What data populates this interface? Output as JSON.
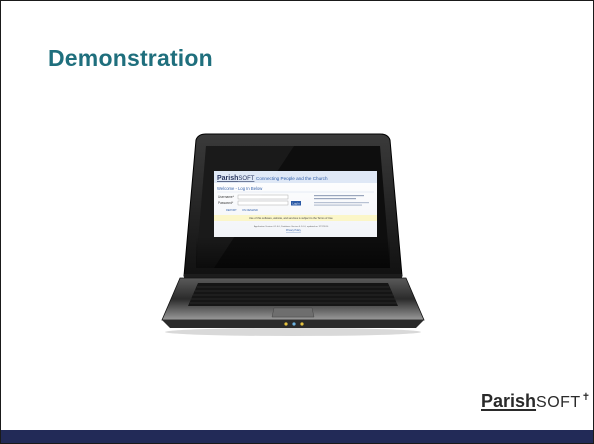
{
  "slide": {
    "title": "Demonstration"
  },
  "screen": {
    "logo_bold": "Parish",
    "logo_light": "SOFT",
    "tagline": "Connecting People and the Church",
    "welcome": "Welcome - Log In Below",
    "username_label": "Username*",
    "password_label": "Password*",
    "login_button": "Log In",
    "link_a": "REPORT",
    "link_b": "ON DEMAND",
    "notice": "Use of this software, website, and services is subject to the Terms of Use",
    "footer_line": "Application Version 4.1.0.0, Database Version 4.1.0.0, updated on 7/27/2010",
    "footer_link": "Privacy Policy"
  },
  "brand": {
    "name_bold": "Parish",
    "name_light": "SOFT"
  },
  "colors": {
    "title": "#1f6f7d",
    "footer_bar": "#222a57",
    "screen_header": "#2b5aa6",
    "notice_bg": "#fbf6c8"
  }
}
